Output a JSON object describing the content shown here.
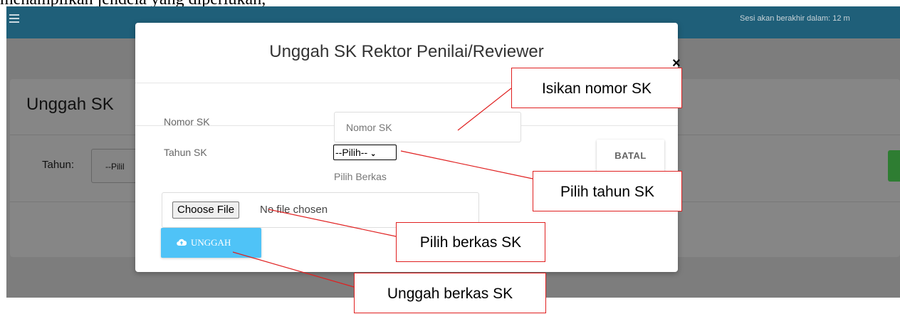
{
  "page_text_top": "menampilkan jendela yang diperlukan,",
  "appbar": {
    "session_text": "Sesi akan berakhir dalam: 12 m"
  },
  "background_page": {
    "title": "Unggah SK",
    "tahun_label": "Tahun:",
    "tahun_select_value": "--Pilil"
  },
  "modal": {
    "title": "Unggah SK Rektor Penilai/Reviewer",
    "close_symbol": "×",
    "nomor_label": "Nomor SK",
    "nomor_placeholder": "Nomor SK",
    "tahun_label": "Tahun SK",
    "tahun_select_value": "--Pilih--",
    "pilih_berkas_label": "Pilih Berkas",
    "batal_label": "BATAL",
    "choose_file_label": "Choose File",
    "no_file_text": "No file chosen",
    "unggah_label": "UNGGAH"
  },
  "callouts": {
    "nomor": "Isikan nomor SK",
    "tahun": "Pilih tahun SK",
    "berkas": "Pilih berkas SK",
    "unggah": "Unggah berkas SK"
  },
  "icons": {
    "menu": "hamburger-menu-icon",
    "close": "close-icon",
    "select": "chevron-down-icon",
    "upload": "cloud-upload-icon"
  },
  "colors": {
    "appbar": "#1f5f79",
    "overlay": "#7d7d7d",
    "unggah_button": "#4fc3f7",
    "callout_border": "#e02020"
  }
}
